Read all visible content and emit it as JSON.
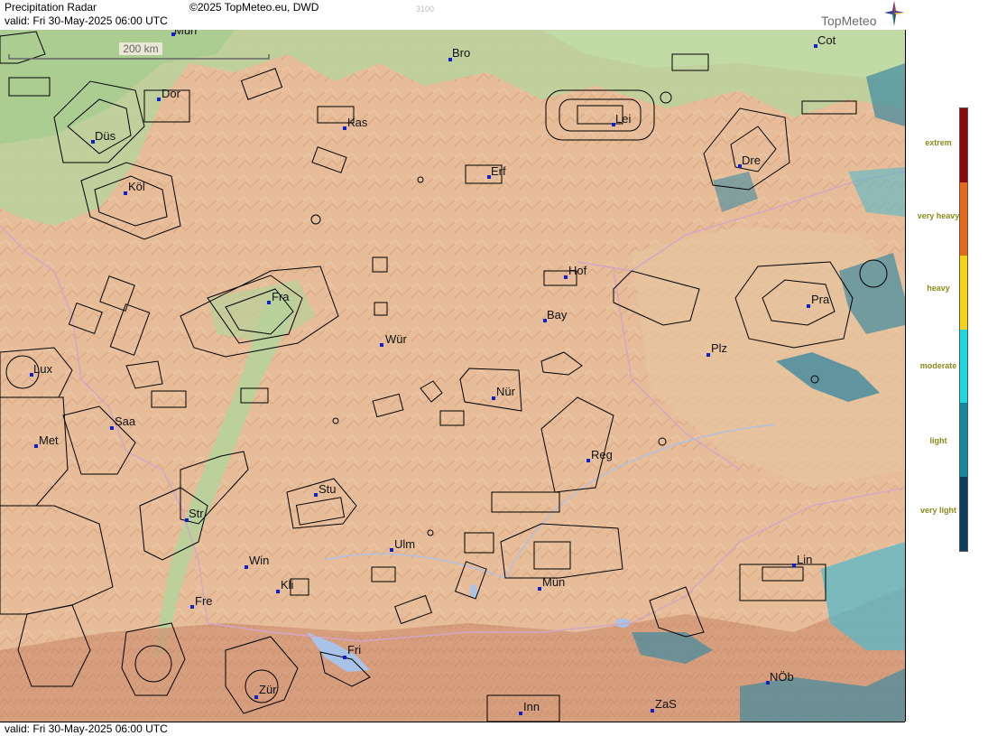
{
  "header": {
    "title": "Precipitation Radar",
    "copyright": "©2025 TopMeteo.eu, DWD",
    "valid_label": "valid:",
    "valid_time": "Fri  30-May-2025 06:00 UTC",
    "faint_number": "3100"
  },
  "logo": {
    "text": "TopMeteo"
  },
  "footer": {
    "valid_label": "valid:",
    "valid_time": "Fri  30-May-2025 06:00 UTC"
  },
  "map": {
    "scale_label": "200 km",
    "cities": [
      {
        "id": "mun-top",
        "label": "Mün"
      },
      {
        "id": "bro",
        "label": "Bro"
      },
      {
        "id": "cot",
        "label": "Cot"
      },
      {
        "id": "dor",
        "label": "Dor"
      },
      {
        "id": "kas",
        "label": "Kas"
      },
      {
        "id": "lei",
        "label": "Lei"
      },
      {
        "id": "dus",
        "label": "Düs"
      },
      {
        "id": "erf",
        "label": "Erf"
      },
      {
        "id": "dre",
        "label": "Dre"
      },
      {
        "id": "kol",
        "label": "Köl"
      },
      {
        "id": "hof",
        "label": "Hof"
      },
      {
        "id": "fra",
        "label": "Fra"
      },
      {
        "id": "pra",
        "label": "Pra"
      },
      {
        "id": "bay",
        "label": "Bay"
      },
      {
        "id": "wur",
        "label": "Wür"
      },
      {
        "id": "plz",
        "label": "Plz"
      },
      {
        "id": "lux",
        "label": "Lux"
      },
      {
        "id": "nur",
        "label": "Nür"
      },
      {
        "id": "saa",
        "label": "Saa"
      },
      {
        "id": "met",
        "label": "Met"
      },
      {
        "id": "reg",
        "label": "Reg"
      },
      {
        "id": "stu",
        "label": "Stu"
      },
      {
        "id": "str",
        "label": "Str"
      },
      {
        "id": "ulm",
        "label": "Ulm"
      },
      {
        "id": "win",
        "label": "Win"
      },
      {
        "id": "lin",
        "label": "Lin"
      },
      {
        "id": "kli",
        "label": "Kli"
      },
      {
        "id": "mun",
        "label": "Mün"
      },
      {
        "id": "fre",
        "label": "Fre"
      },
      {
        "id": "fri",
        "label": "Fri"
      },
      {
        "id": "nob",
        "label": "NÖb"
      },
      {
        "id": "zur",
        "label": "Zür"
      },
      {
        "id": "inn",
        "label": "Inn"
      },
      {
        "id": "zas",
        "label": "ZaS"
      }
    ]
  },
  "legend": {
    "items": [
      {
        "label": "extrem",
        "color": "#8b0a0a"
      },
      {
        "label": "very heavy",
        "color": "#e8681a"
      },
      {
        "label": "heavy",
        "color": "#f5d213"
      },
      {
        "label": "moderate",
        "color": "#1ed6e0"
      },
      {
        "label": "light",
        "color": "#14889a"
      },
      {
        "label": "very light",
        "color": "#0c3d5c"
      }
    ]
  },
  "colors": {
    "terrain_low": "#b9d6a0",
    "terrain_mid": "#e8c4a0",
    "terrain_high": "#d9a07a",
    "precip_very_light": "#3f8aa0",
    "precip_light": "#56b8c8",
    "city_marker": "#1020c8"
  }
}
